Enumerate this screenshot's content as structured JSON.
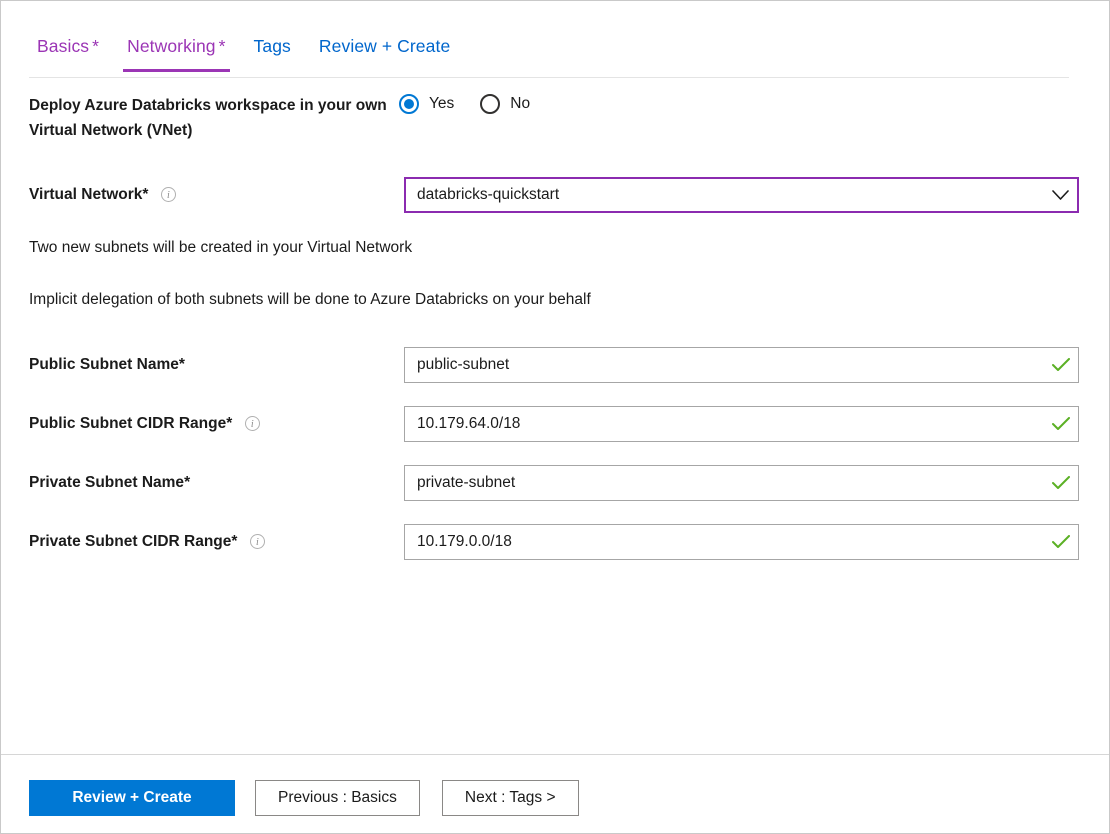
{
  "wizard": {
    "tabs": [
      {
        "label": "Basics",
        "required": "*",
        "state": "visited"
      },
      {
        "label": "Networking",
        "required": "*",
        "state": "active"
      },
      {
        "label": "Tags",
        "required": "",
        "state": "default"
      },
      {
        "label": "Review + Create",
        "required": "",
        "state": "default"
      }
    ]
  },
  "form": {
    "deploy_vnet": {
      "label": "Deploy Azure Databricks workspace in your own Virtual Network (VNet)",
      "options": [
        {
          "label": "Yes",
          "selected": true
        },
        {
          "label": "No",
          "selected": false
        }
      ]
    },
    "virtual_network": {
      "label": "Virtual Network",
      "required": "*",
      "info_icon": "info-icon",
      "value": "databricks-quickstart",
      "dropdown_icon": "chevron-down-icon"
    },
    "notes": [
      "Two new subnets will be created in your Virtual Network",
      "Implicit delegation of both subnets will be done to Azure Databricks on your behalf"
    ],
    "public_subnet_name": {
      "label": "Public Subnet Name",
      "required": "*",
      "value": "public-subnet",
      "validation_icon": "checkmark-icon"
    },
    "public_subnet_cidr": {
      "label": "Public Subnet CIDR Range",
      "required": "*",
      "info_icon": "info-icon",
      "value": "10.179.64.0/18",
      "validation_icon": "checkmark-icon"
    },
    "private_subnet_name": {
      "label": "Private Subnet Name",
      "required": "*",
      "value": "private-subnet",
      "validation_icon": "checkmark-icon"
    },
    "private_subnet_cidr": {
      "label": "Private Subnet CIDR Range",
      "required": "*",
      "info_icon": "info-icon",
      "value": "10.179.0.0/18",
      "validation_icon": "checkmark-icon"
    }
  },
  "footer": {
    "review_create": "Review + Create",
    "previous": "Previous : Basics",
    "next": "Next : Tags >"
  },
  "colors": {
    "accent_blue": "#0078d4",
    "link_blue": "#0066cc",
    "tab_purple": "#9b35b5",
    "focus_purple": "#8b2bb0",
    "required_red": "#a4262c",
    "valid_green": "#5bb025"
  }
}
